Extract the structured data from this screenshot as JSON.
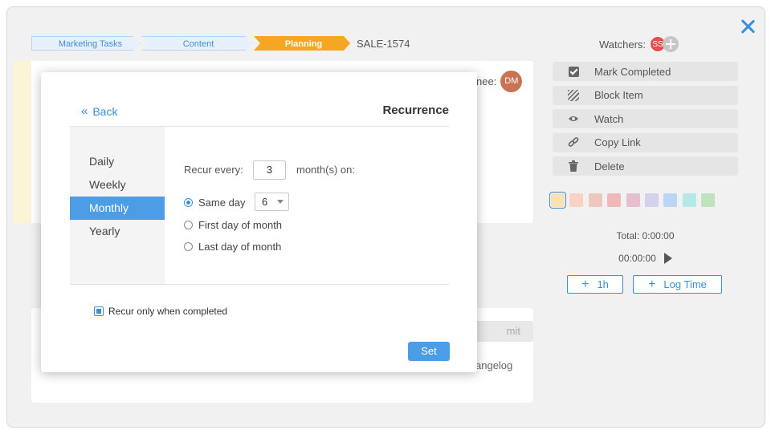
{
  "breadcrumb": {
    "items": [
      "Marketing Tasks",
      "Content",
      "Planning"
    ],
    "task_id": "SALE-1574"
  },
  "watchers": {
    "label": "Watchers:",
    "avatar": "SS"
  },
  "assignee": {
    "label_fragment": "nee:",
    "avatar": "DM"
  },
  "actions": [
    {
      "label": "Mark Completed",
      "icon": "checkbox-icon"
    },
    {
      "label": "Block Item",
      "icon": "hatch-icon"
    },
    {
      "label": "Watch",
      "icon": "eye-icon"
    },
    {
      "label": "Copy Link",
      "icon": "link-icon"
    },
    {
      "label": "Delete",
      "icon": "trash-icon"
    }
  ],
  "swatches": [
    "#fbe2b4",
    "#f9d2c3",
    "#ecc8bf",
    "#f0b8b6",
    "#e5bfd0",
    "#d5d0ec",
    "#bad6f5",
    "#b5e9e6",
    "#bfe3bd",
    "#f0f0f0"
  ],
  "time": {
    "total": "Total: 0:00:00",
    "timer": "00:00:00",
    "add_hour": "1h",
    "log_time": "Log Time"
  },
  "background": {
    "submit_fragment": "mit",
    "changelog_fragment": "angelog"
  },
  "modal": {
    "back": "Back",
    "title": "Recurrence",
    "frequencies": [
      "Daily",
      "Weekly",
      "Monthly",
      "Yearly"
    ],
    "selected_frequency": "Monthly",
    "recur_every_label": "Recur every:",
    "recur_every_value": "3",
    "recur_unit": "month(s) on:",
    "options": [
      "Same day",
      "First day of month",
      "Last day of month"
    ],
    "selected_option": "Same day",
    "same_day_value": "6",
    "only_completed": "Recur only when completed",
    "set": "Set"
  },
  "colors": {
    "accent": "#3b8fd8",
    "active_blue": "#4d9de6",
    "breadcrumb_active": "#f5a623"
  }
}
